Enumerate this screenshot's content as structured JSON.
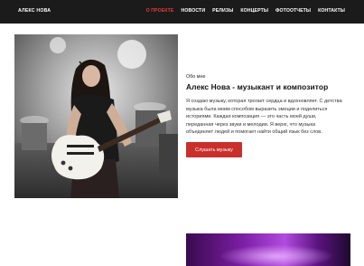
{
  "header": {
    "brand": "АЛЕКС НОВА",
    "nav": [
      {
        "label": "О ПРОЕКТЕ",
        "active": true
      },
      {
        "label": "НОВОСТИ",
        "active": false
      },
      {
        "label": "РЕЛИЗЫ",
        "active": false
      },
      {
        "label": "КОНЦЕРТЫ",
        "active": false
      },
      {
        "label": "ФОТООТЧЕТЫ",
        "active": false
      },
      {
        "label": "КОНТАКТЫ",
        "active": false
      }
    ]
  },
  "about": {
    "kicker": "Обо мне",
    "title": "Алекс Нова - музыкант и композитор",
    "lines": [
      "Я создаю музыку, которая трогает сердца и вдохновляет. С детства",
      "музыка была моим способом выразить эмоции и поделиться",
      "историями. Каждая композиция — это часть моей души,",
      "переданная через звуки и мелодии. Я верю, что музыка",
      "объединяет людей и помогает найти общий язык без слов."
    ],
    "button_label": "Слушать музыку"
  },
  "colors": {
    "topbar": "#1b1b1b",
    "accent": "#e53935",
    "button": "#c9302c"
  }
}
